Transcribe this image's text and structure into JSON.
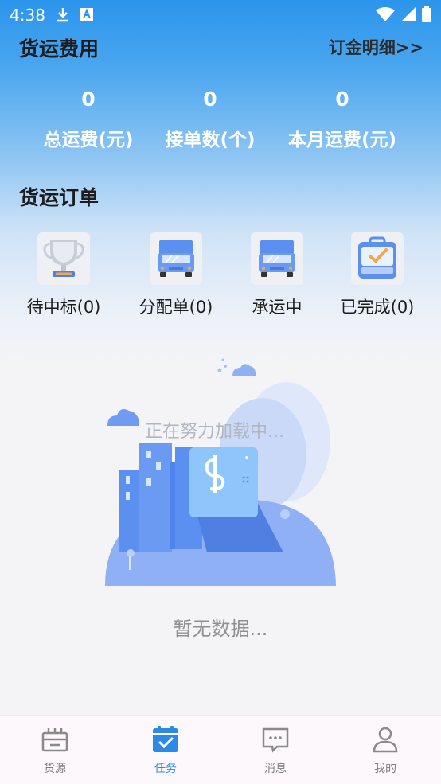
{
  "status_bar": {
    "time": "4:38"
  },
  "fees": {
    "title": "货运费用",
    "detail_link": "订金明细>>",
    "stats": [
      {
        "value": "0",
        "label": "总运费(元)"
      },
      {
        "value": "0",
        "label": "接单数(个)"
      },
      {
        "value": "0",
        "label": "本月运费(元)"
      }
    ]
  },
  "orders": {
    "title": "货运订单",
    "items": [
      {
        "label": "待中标(0)",
        "icon": "trophy-icon"
      },
      {
        "label": "分配单(0)",
        "icon": "truck-icon"
      },
      {
        "label": "承运中",
        "icon": "truck-icon"
      },
      {
        "label": "已完成(0)",
        "icon": "check-bag-icon"
      }
    ]
  },
  "content": {
    "loading_text": "正在努力加载中...",
    "empty_text": "暂无数据..."
  },
  "bottom_nav": {
    "items": [
      {
        "label": "货源",
        "icon": "cargo-icon"
      },
      {
        "label": "任务",
        "icon": "calendar-check-icon"
      },
      {
        "label": "消息",
        "icon": "message-icon"
      },
      {
        "label": "我的",
        "icon": "user-icon"
      }
    ],
    "active_index": 1,
    "active_color": "#2a8ae6",
    "inactive_color": "#7d7d7d"
  },
  "colors": {
    "header_blue": "#2b95ec",
    "accent": "#2a8ae6"
  }
}
